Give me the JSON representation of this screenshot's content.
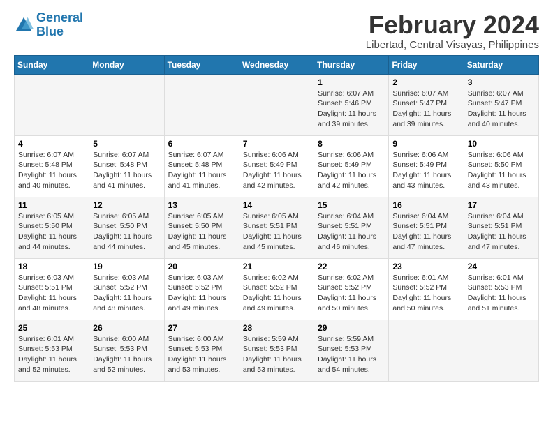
{
  "logo": {
    "line1": "General",
    "line2": "Blue"
  },
  "title": "February 2024",
  "subtitle": "Libertad, Central Visayas, Philippines",
  "weekdays": [
    "Sunday",
    "Monday",
    "Tuesday",
    "Wednesday",
    "Thursday",
    "Friday",
    "Saturday"
  ],
  "weeks": [
    [
      {
        "day": "",
        "info": ""
      },
      {
        "day": "",
        "info": ""
      },
      {
        "day": "",
        "info": ""
      },
      {
        "day": "",
        "info": ""
      },
      {
        "day": "1",
        "info": "Sunrise: 6:07 AM\nSunset: 5:46 PM\nDaylight: 11 hours\nand 39 minutes."
      },
      {
        "day": "2",
        "info": "Sunrise: 6:07 AM\nSunset: 5:47 PM\nDaylight: 11 hours\nand 39 minutes."
      },
      {
        "day": "3",
        "info": "Sunrise: 6:07 AM\nSunset: 5:47 PM\nDaylight: 11 hours\nand 40 minutes."
      }
    ],
    [
      {
        "day": "4",
        "info": "Sunrise: 6:07 AM\nSunset: 5:48 PM\nDaylight: 11 hours\nand 40 minutes."
      },
      {
        "day": "5",
        "info": "Sunrise: 6:07 AM\nSunset: 5:48 PM\nDaylight: 11 hours\nand 41 minutes."
      },
      {
        "day": "6",
        "info": "Sunrise: 6:07 AM\nSunset: 5:48 PM\nDaylight: 11 hours\nand 41 minutes."
      },
      {
        "day": "7",
        "info": "Sunrise: 6:06 AM\nSunset: 5:49 PM\nDaylight: 11 hours\nand 42 minutes."
      },
      {
        "day": "8",
        "info": "Sunrise: 6:06 AM\nSunset: 5:49 PM\nDaylight: 11 hours\nand 42 minutes."
      },
      {
        "day": "9",
        "info": "Sunrise: 6:06 AM\nSunset: 5:49 PM\nDaylight: 11 hours\nand 43 minutes."
      },
      {
        "day": "10",
        "info": "Sunrise: 6:06 AM\nSunset: 5:50 PM\nDaylight: 11 hours\nand 43 minutes."
      }
    ],
    [
      {
        "day": "11",
        "info": "Sunrise: 6:05 AM\nSunset: 5:50 PM\nDaylight: 11 hours\nand 44 minutes."
      },
      {
        "day": "12",
        "info": "Sunrise: 6:05 AM\nSunset: 5:50 PM\nDaylight: 11 hours\nand 44 minutes."
      },
      {
        "day": "13",
        "info": "Sunrise: 6:05 AM\nSunset: 5:50 PM\nDaylight: 11 hours\nand 45 minutes."
      },
      {
        "day": "14",
        "info": "Sunrise: 6:05 AM\nSunset: 5:51 PM\nDaylight: 11 hours\nand 45 minutes."
      },
      {
        "day": "15",
        "info": "Sunrise: 6:04 AM\nSunset: 5:51 PM\nDaylight: 11 hours\nand 46 minutes."
      },
      {
        "day": "16",
        "info": "Sunrise: 6:04 AM\nSunset: 5:51 PM\nDaylight: 11 hours\nand 47 minutes."
      },
      {
        "day": "17",
        "info": "Sunrise: 6:04 AM\nSunset: 5:51 PM\nDaylight: 11 hours\nand 47 minutes."
      }
    ],
    [
      {
        "day": "18",
        "info": "Sunrise: 6:03 AM\nSunset: 5:51 PM\nDaylight: 11 hours\nand 48 minutes."
      },
      {
        "day": "19",
        "info": "Sunrise: 6:03 AM\nSunset: 5:52 PM\nDaylight: 11 hours\nand 48 minutes."
      },
      {
        "day": "20",
        "info": "Sunrise: 6:03 AM\nSunset: 5:52 PM\nDaylight: 11 hours\nand 49 minutes."
      },
      {
        "day": "21",
        "info": "Sunrise: 6:02 AM\nSunset: 5:52 PM\nDaylight: 11 hours\nand 49 minutes."
      },
      {
        "day": "22",
        "info": "Sunrise: 6:02 AM\nSunset: 5:52 PM\nDaylight: 11 hours\nand 50 minutes."
      },
      {
        "day": "23",
        "info": "Sunrise: 6:01 AM\nSunset: 5:52 PM\nDaylight: 11 hours\nand 50 minutes."
      },
      {
        "day": "24",
        "info": "Sunrise: 6:01 AM\nSunset: 5:53 PM\nDaylight: 11 hours\nand 51 minutes."
      }
    ],
    [
      {
        "day": "25",
        "info": "Sunrise: 6:01 AM\nSunset: 5:53 PM\nDaylight: 11 hours\nand 52 minutes."
      },
      {
        "day": "26",
        "info": "Sunrise: 6:00 AM\nSunset: 5:53 PM\nDaylight: 11 hours\nand 52 minutes."
      },
      {
        "day": "27",
        "info": "Sunrise: 6:00 AM\nSunset: 5:53 PM\nDaylight: 11 hours\nand 53 minutes."
      },
      {
        "day": "28",
        "info": "Sunrise: 5:59 AM\nSunset: 5:53 PM\nDaylight: 11 hours\nand 53 minutes."
      },
      {
        "day": "29",
        "info": "Sunrise: 5:59 AM\nSunset: 5:53 PM\nDaylight: 11 hours\nand 54 minutes."
      },
      {
        "day": "",
        "info": ""
      },
      {
        "day": "",
        "info": ""
      }
    ]
  ]
}
